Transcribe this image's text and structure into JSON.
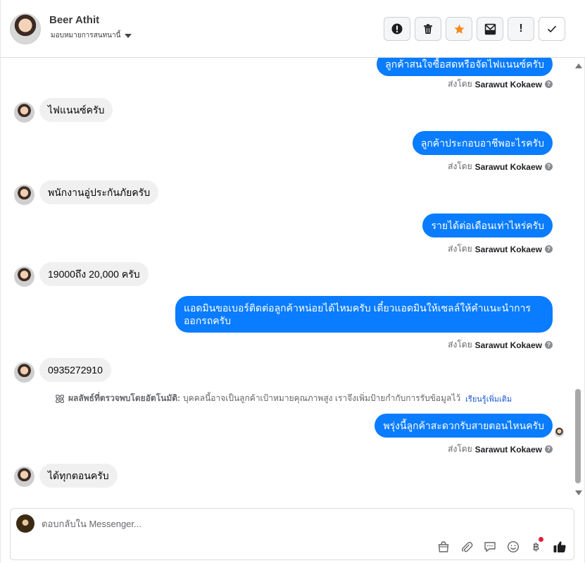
{
  "header": {
    "name": "Beer Athit",
    "assign_label": "มอบหมายการสนทนานี้",
    "tools": [
      "report-icon",
      "trash-icon",
      "star-icon",
      "mark-unread-icon",
      "important-icon",
      "check-icon"
    ],
    "tool_glyphs": [
      "!",
      "🗑",
      "★",
      "✉",
      "!",
      "✓"
    ]
  },
  "messages": {
    "out1": "ลูกค้าสนใจซื้อสดหรือจัดไฟแนนซ์ครับ",
    "in1": "ไฟแนนซ์ครับ",
    "out2": "ลูกค้าประกอบอาชีพอะไรครับ",
    "in2": "พนักงานอู่ประกันภัยครับ",
    "out3": "รายได้ต่อเดือนเท่าไหร่ครับ",
    "in3": "19000ถึง 20,000 ครับ",
    "out4": "แอดมินขอเบอร์ติดต่อลูกค้าหน่อยได้ไหมครับ เดี๋ยวแอดมินให้เซลล์ให้คำแนะนำการออกรถครับ",
    "in4": "0935272910",
    "out5": "พรุ่งนี้ลูกค้าสะดวกรับสายตอนไหนครับ",
    "in5": "ได้ทุกตอนครับ"
  },
  "sent_by": {
    "prefix": "ส่งโดย",
    "name": "Sarawut Kokaew"
  },
  "ai_note": {
    "title": "ผลลัพธ์ที่ตรวจพบโดยอัตโนมัติ:",
    "body": "บุคคลนี้อาจเป็นลูกค้าเป้าหมายคุณภาพสูง เราจึงเพิ่มป้ายกำกับการรับข้อมูลไว้",
    "more": "เรียนรู้เพิ่มเติม"
  },
  "composer": {
    "placeholder": "ตอบกลับใน Messenger...",
    "icons": [
      "shop-icon",
      "attach-icon",
      "saved-reply-icon",
      "emoji-icon",
      "payment-icon",
      "like-icon"
    ]
  }
}
